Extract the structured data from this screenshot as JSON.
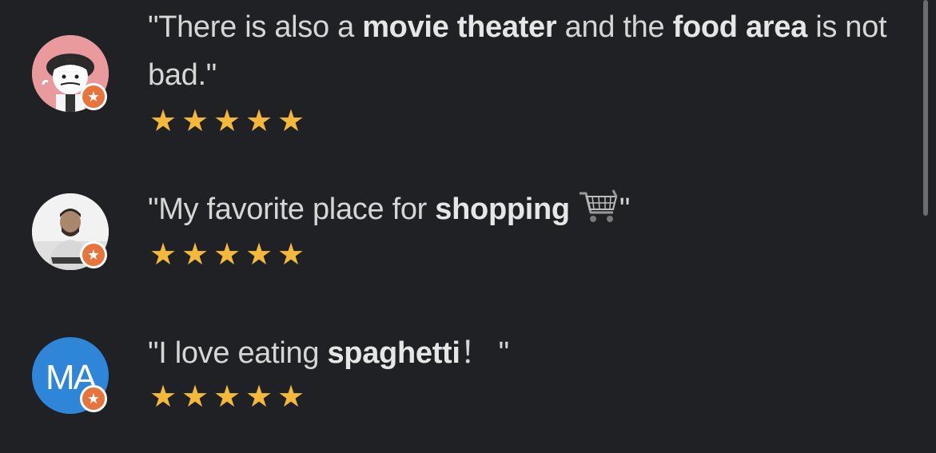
{
  "reviews": [
    {
      "avatar": {
        "type": "illustration",
        "icon": "cartoon-person-icon",
        "background": "#e99a9c"
      },
      "badge_icon": "local-guide-star-icon",
      "quote": {
        "open": "\"There is also a ",
        "bold1": "movie theater",
        "mid": " and the ",
        "bold2": "food area",
        "close": " is not bad.\""
      },
      "rating": 5
    },
    {
      "avatar": {
        "type": "photo",
        "icon": "person-photo-icon",
        "background": "#f2f2f2"
      },
      "badge_icon": "local-guide-star-icon",
      "quote": {
        "open": "\"My favorite place for ",
        "bold1": "shopping",
        "emoji": "shopping-cart-icon",
        "close": "\""
      },
      "rating": 5
    },
    {
      "avatar": {
        "type": "initials",
        "initials": "MA",
        "background": "#2f86d8"
      },
      "badge_icon": "local-guide-star-icon",
      "quote": {
        "open": "\"I love eating ",
        "bold1": "spaghetti",
        "close": "！ \""
      },
      "rating": 5
    }
  ],
  "colors": {
    "background": "#202124",
    "text": "#d6d6d6",
    "star": "#f4b93a",
    "badge": "#e8743b"
  }
}
